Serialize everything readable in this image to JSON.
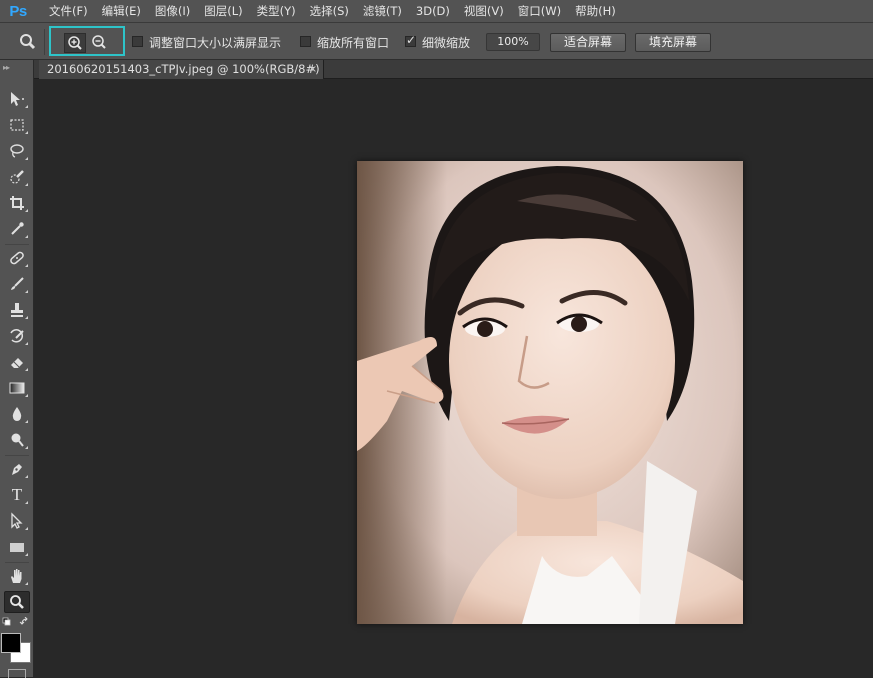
{
  "app": {
    "logo": "Ps"
  },
  "menu": [
    "文件(F)",
    "编辑(E)",
    "图像(I)",
    "图层(L)",
    "类型(Y)",
    "选择(S)",
    "滤镜(T)",
    "3D(D)",
    "视图(V)",
    "窗口(W)",
    "帮助(H)"
  ],
  "options": {
    "tool_icon": "zoom-icon",
    "zoom_in_icon": "zoom-in-icon",
    "zoom_out_icon": "zoom-out-icon",
    "resize_windows": {
      "label": "调整窗口大小以满屏显示",
      "checked": false
    },
    "zoom_all_windows": {
      "label": "缩放所有窗口",
      "checked": false
    },
    "scrubby_zoom": {
      "label": "细微缩放",
      "checked": true
    },
    "zoom_percent": "100%",
    "fit_screen_label": "适合屏幕",
    "fill_screen_label": "填充屏幕",
    "highlight_color": "#2ec4c9"
  },
  "document": {
    "tab_title": "20160620151403_cTPJv.jpeg @ 100%(RGB/8#)",
    "close_glyph": "×"
  },
  "toolbar": {
    "tools": [
      "move-tool",
      "marquee-tool",
      "lasso-tool",
      "quick-select-tool",
      "crop-tool",
      "eyedropper-tool",
      "healing-brush-tool",
      "brush-tool",
      "clone-stamp-tool",
      "history-brush-tool",
      "eraser-tool",
      "gradient-tool",
      "blur-tool",
      "dodge-tool",
      "pen-tool",
      "type-tool",
      "path-selection-tool",
      "rectangle-tool",
      "hand-tool",
      "zoom-tool"
    ],
    "selected_tool": "zoom-tool",
    "type_tool_glyph": "T",
    "foreground_color": "#000000",
    "background_color": "#ffffff"
  },
  "colors": {
    "ui_panel": "#535353",
    "canvas_bg": "#282828",
    "logo_blue": "#31a8ff"
  }
}
